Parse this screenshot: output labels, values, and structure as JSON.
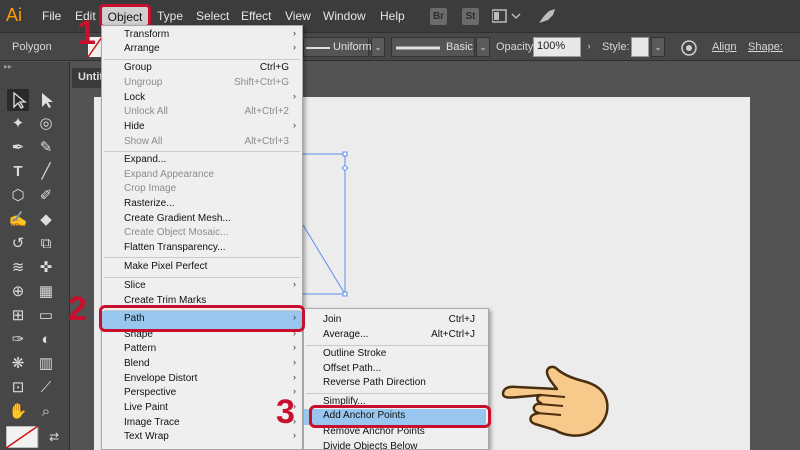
{
  "menubar": {
    "app_logo": "Ai",
    "items": [
      "File",
      "Edit",
      "Object",
      "Type",
      "Select",
      "Effect",
      "View",
      "Window",
      "Help"
    ],
    "bridge": "Br",
    "stock": "St"
  },
  "controlbar": {
    "selection": "Polygon",
    "stroke_profile": "Uniform",
    "brush": "Basic",
    "opacity_label": "Opacity:",
    "opacity_value": "100%",
    "style_label": "Style:",
    "align_label": "Align",
    "shape_label": "Shape:"
  },
  "document": {
    "tab_title": "Untit"
  },
  "object_menu": {
    "items": [
      {
        "label": "Transform",
        "shortcut": "",
        "submenu": true,
        "disabled": false
      },
      {
        "label": "Arrange",
        "shortcut": "",
        "submenu": true,
        "disabled": false
      },
      {
        "label": "Group",
        "shortcut": "Ctrl+G",
        "submenu": false,
        "disabled": false
      },
      {
        "label": "Ungroup",
        "shortcut": "Shift+Ctrl+G",
        "submenu": false,
        "disabled": true
      },
      {
        "label": "Lock",
        "shortcut": "",
        "submenu": true,
        "disabled": false
      },
      {
        "label": "Unlock All",
        "shortcut": "Alt+Ctrl+2",
        "submenu": false,
        "disabled": true
      },
      {
        "label": "Hide",
        "shortcut": "",
        "submenu": true,
        "disabled": false
      },
      {
        "label": "Show All",
        "shortcut": "Alt+Ctrl+3",
        "submenu": false,
        "disabled": true
      },
      {
        "label": "Expand...",
        "shortcut": "",
        "submenu": false,
        "disabled": false
      },
      {
        "label": "Expand Appearance",
        "shortcut": "",
        "submenu": false,
        "disabled": true
      },
      {
        "label": "Crop Image",
        "shortcut": "",
        "submenu": false,
        "disabled": true
      },
      {
        "label": "Rasterize...",
        "shortcut": "",
        "submenu": false,
        "disabled": false
      },
      {
        "label": "Create Gradient Mesh...",
        "shortcut": "",
        "submenu": false,
        "disabled": false
      },
      {
        "label": "Create Object Mosaic...",
        "shortcut": "",
        "submenu": false,
        "disabled": true
      },
      {
        "label": "Flatten Transparency...",
        "shortcut": "",
        "submenu": false,
        "disabled": false
      },
      {
        "label": "Make Pixel Perfect",
        "shortcut": "",
        "submenu": false,
        "disabled": false
      },
      {
        "label": "Slice",
        "shortcut": "",
        "submenu": true,
        "disabled": false
      },
      {
        "label": "Create Trim Marks",
        "shortcut": "",
        "submenu": false,
        "disabled": false
      },
      {
        "label": "Path",
        "shortcut": "",
        "submenu": true,
        "disabled": false
      },
      {
        "label": "Shape",
        "shortcut": "",
        "submenu": true,
        "disabled": false
      },
      {
        "label": "Pattern",
        "shortcut": "",
        "submenu": true,
        "disabled": false
      },
      {
        "label": "Blend",
        "shortcut": "",
        "submenu": true,
        "disabled": false
      },
      {
        "label": "Envelope Distort",
        "shortcut": "",
        "submenu": true,
        "disabled": false
      },
      {
        "label": "Perspective",
        "shortcut": "",
        "submenu": true,
        "disabled": false
      },
      {
        "label": "Live Paint",
        "shortcut": "",
        "submenu": true,
        "disabled": false
      },
      {
        "label": "Image Trace",
        "shortcut": "",
        "submenu": true,
        "disabled": false
      },
      {
        "label": "Text Wrap",
        "shortcut": "",
        "submenu": true,
        "disabled": false
      }
    ]
  },
  "path_submenu": {
    "items": [
      {
        "label": "Join",
        "shortcut": "Ctrl+J"
      },
      {
        "label": "Average...",
        "shortcut": "Alt+Ctrl+J"
      },
      {
        "label": "Outline Stroke",
        "shortcut": ""
      },
      {
        "label": "Offset Path...",
        "shortcut": ""
      },
      {
        "label": "Reverse Path Direction",
        "shortcut": ""
      },
      {
        "label": "Simplify...",
        "shortcut": ""
      },
      {
        "label": "Add Anchor Points",
        "shortcut": ""
      },
      {
        "label": "Remove Anchor Points",
        "shortcut": ""
      },
      {
        "label": "Divide Objects Below",
        "shortcut": ""
      }
    ]
  },
  "annotations": {
    "step1": "1",
    "step2": "2",
    "step3": "3"
  },
  "colors": {
    "highlight": "#98c6ee",
    "callout": "#c8102e",
    "menubar": "#3c3c3c",
    "app_accent": "#ff9a00"
  }
}
